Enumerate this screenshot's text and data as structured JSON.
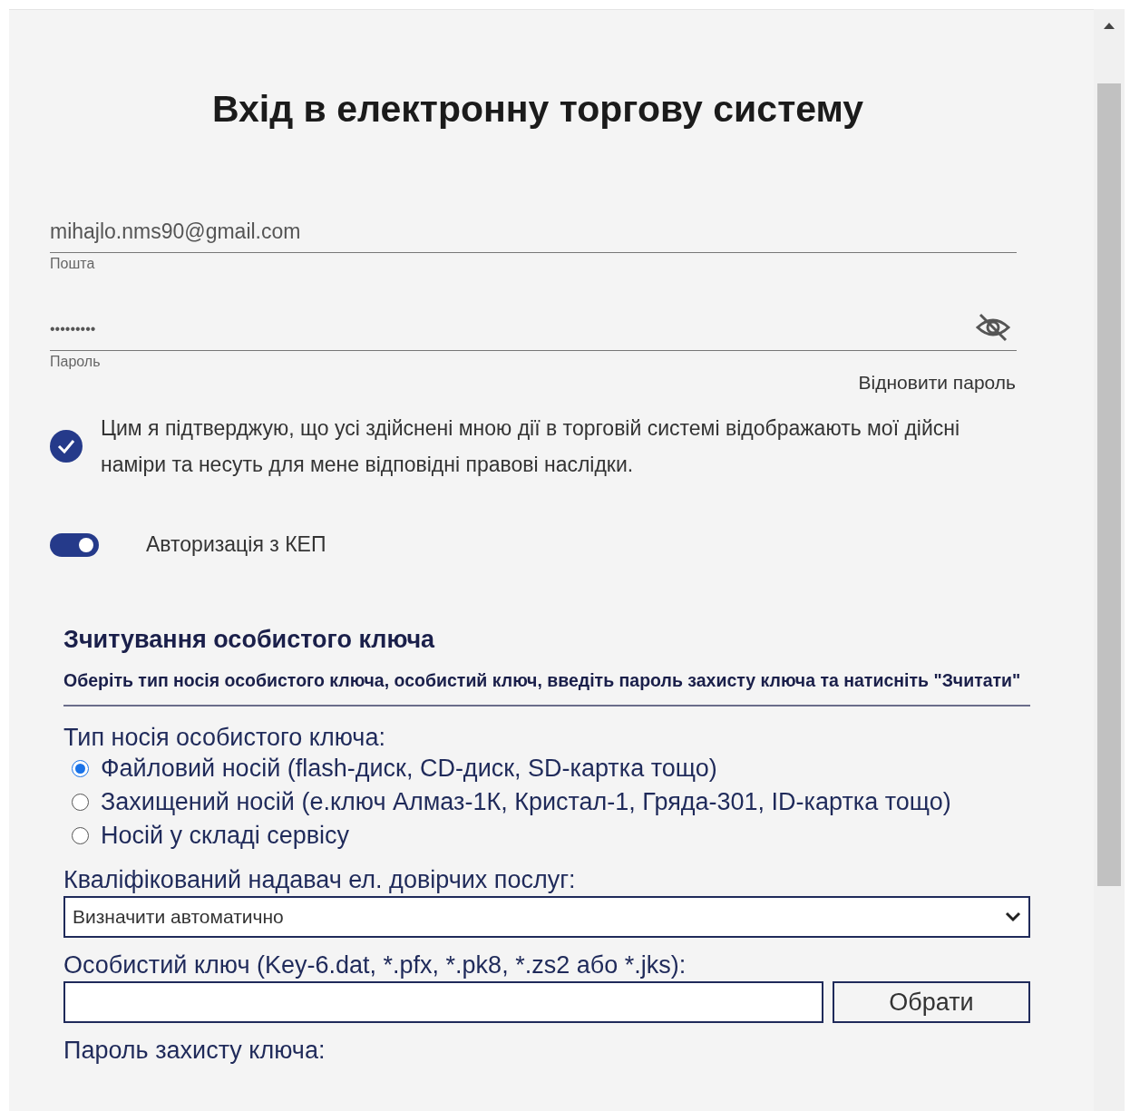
{
  "title": "Вхід в електронну торгову систему",
  "email": {
    "value": "mihajlo.nms90@gmail.com",
    "label": "Пошта"
  },
  "password": {
    "value": "•••••••••",
    "label": "Пароль",
    "visible": false
  },
  "restore_link": "Відновити пароль",
  "consent": {
    "checked": true,
    "text": "Цим я підтверджую, що усі здійснені мною дії в торговій системі відображають мої дійсні наміри та несуть для мене відповідні правові наслідки."
  },
  "kep_toggle": {
    "on": true,
    "label": "Авторизація з КЕП"
  },
  "key_section": {
    "title": "Зчитування особистого ключа",
    "description": "Оберіть тип носія особистого ключа, особистий ключ, введіть пароль захисту ключа та натисніть \"Зчитати\"",
    "carrier_label": "Тип носія особистого ключа:",
    "carrier_options": [
      {
        "label": "Файловий носій (flash-диск, CD-диск, SD-картка тощо)",
        "selected": true
      },
      {
        "label": "Захищений носій (е.ключ Алмаз-1К, Кристал-1, Гряда-301, ID-картка тощо)",
        "selected": false
      },
      {
        "label": "Носій у складі сервісу",
        "selected": false
      }
    ],
    "provider": {
      "label": "Кваліфікований надавач ел. довірчих послуг:",
      "value": "Визначити автоматично"
    },
    "key_file": {
      "label": "Особистий ключ (Key-6.dat, *.pfx, *.pk8, *.zs2 або *.jks):",
      "button": "Обрати"
    },
    "password_label": "Пароль захисту ключа:"
  }
}
